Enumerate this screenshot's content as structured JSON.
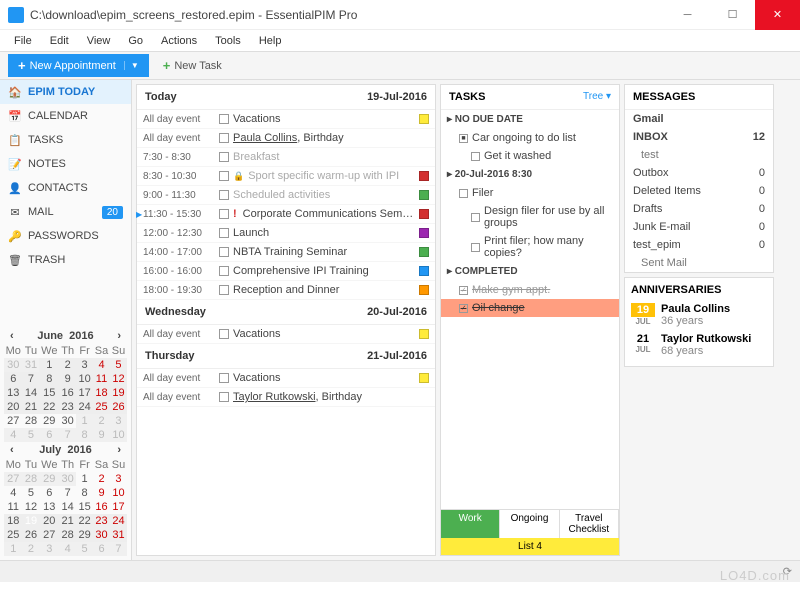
{
  "window": {
    "title": "C:\\download\\epim_screens_restored.epim - EssentialPIM Pro"
  },
  "menu": [
    "File",
    "Edit",
    "View",
    "Go",
    "Actions",
    "Tools",
    "Help"
  ],
  "toolbar": {
    "new_appt": "New Appointment",
    "new_task": "New Task"
  },
  "nav": {
    "items": [
      {
        "label": "EPIM TODAY",
        "icon": "🏠",
        "active": true
      },
      {
        "label": "CALENDAR",
        "icon": "📅"
      },
      {
        "label": "TASKS",
        "icon": "📋"
      },
      {
        "label": "NOTES",
        "icon": "📝"
      },
      {
        "label": "CONTACTS",
        "icon": "👤"
      },
      {
        "label": "MAIL",
        "icon": "✉",
        "badge": "20"
      },
      {
        "label": "PASSWORDS",
        "icon": "🔑"
      },
      {
        "label": "TRASH",
        "icon": "🗑"
      }
    ]
  },
  "minical": [
    {
      "month": "June",
      "year": "2016"
    },
    {
      "month": "July",
      "year": "2016"
    }
  ],
  "schedule": [
    {
      "title": "Today",
      "date": "19-Jul-2016",
      "events": [
        {
          "time": "All day event",
          "txt": "Vacations",
          "clr": "#FFEB3B"
        },
        {
          "time": "All day event",
          "txt": "Paula Collins, Birthday",
          "underline": true
        },
        {
          "time": "7:30 - 8:30",
          "txt": "Breakfast",
          "muted": true
        },
        {
          "time": "8:30 - 10:30",
          "txt": "Sport specific warm-up with IPI",
          "clr": "#d32f2f",
          "muted": true,
          "lock": true
        },
        {
          "time": "9:00 - 11:30",
          "txt": "Scheduled activities",
          "clr": "#4CAF50",
          "muted": true
        },
        {
          "time": "11:30 - 15:30",
          "txt": "Corporate Communications Seminar",
          "clr": "#d32f2f",
          "tick": true,
          "bang": true
        },
        {
          "time": "12:00 - 12:30",
          "txt": "Launch",
          "clr": "#9C27B0"
        },
        {
          "time": "14:00 - 17:00",
          "txt": "NBTA Training Seminar",
          "clr": "#4CAF50"
        },
        {
          "time": "16:00 - 16:00",
          "txt": "Comprehensive IPI Training",
          "clr": "#2196F3"
        },
        {
          "time": "18:00 - 19:30",
          "txt": "Reception and Dinner",
          "clr": "#FF9800"
        }
      ]
    },
    {
      "title": "Wednesday",
      "date": "20-Jul-2016",
      "events": [
        {
          "time": "All day event",
          "txt": "Vacations",
          "clr": "#FFEB3B"
        }
      ]
    },
    {
      "title": "Thursday",
      "date": "21-Jul-2016",
      "events": [
        {
          "time": "All day event",
          "txt": "Vacations",
          "clr": "#FFEB3B"
        },
        {
          "time": "All day event",
          "txt": "Taylor Rutkowski, Birthday",
          "underline": true
        }
      ]
    }
  ],
  "tasks": {
    "title": "TASKS",
    "view": "Tree ▾",
    "groups": [
      {
        "name": "NO DUE DATE",
        "items": [
          {
            "txt": "Car ongoing to do list",
            "lvl": 0,
            "box": "■"
          },
          {
            "txt": "Get it washed",
            "lvl": 1
          }
        ]
      },
      {
        "name": "20-Jul-2016 8:30",
        "items": [
          {
            "txt": "Filer",
            "lvl": 0
          },
          {
            "txt": "Design filer for use by all groups",
            "lvl": 1
          },
          {
            "txt": "Print filer; how many copies?",
            "lvl": 1
          }
        ]
      },
      {
        "name": "COMPLETED",
        "items": [
          {
            "txt": "Make gym appt.",
            "done": true,
            "chk": true
          },
          {
            "txt": "Oil change",
            "done": true,
            "sel": true,
            "chk": true
          }
        ]
      }
    ],
    "tabs": [
      "Work",
      "Ongoing",
      "Travel Checklist"
    ],
    "list4": "List 4"
  },
  "messages": {
    "title": "MESSAGES",
    "account": "Gmail",
    "folders": [
      {
        "n": "INBOX",
        "c": "12",
        "bold": true
      },
      {
        "n": "test",
        "c": "",
        "sub": true
      },
      {
        "n": "Outbox",
        "c": "0"
      },
      {
        "n": "Deleted Items",
        "c": "0"
      },
      {
        "n": "Drafts",
        "c": "0"
      },
      {
        "n": "Junk E-mail",
        "c": "0"
      },
      {
        "n": "test_epim",
        "c": "0"
      },
      {
        "n": "Sent Mail",
        "c": "",
        "sub": true
      }
    ]
  },
  "anniversaries": {
    "title": "ANNIVERSARIES",
    "items": [
      {
        "d": "19",
        "m": "JUL",
        "name": "Paula Collins",
        "age": "36 years",
        "hl": true
      },
      {
        "d": "21",
        "m": "JUL",
        "name": "Taylor Rutkowski",
        "age": "68 years"
      }
    ]
  },
  "watermark": "LO4D.com"
}
